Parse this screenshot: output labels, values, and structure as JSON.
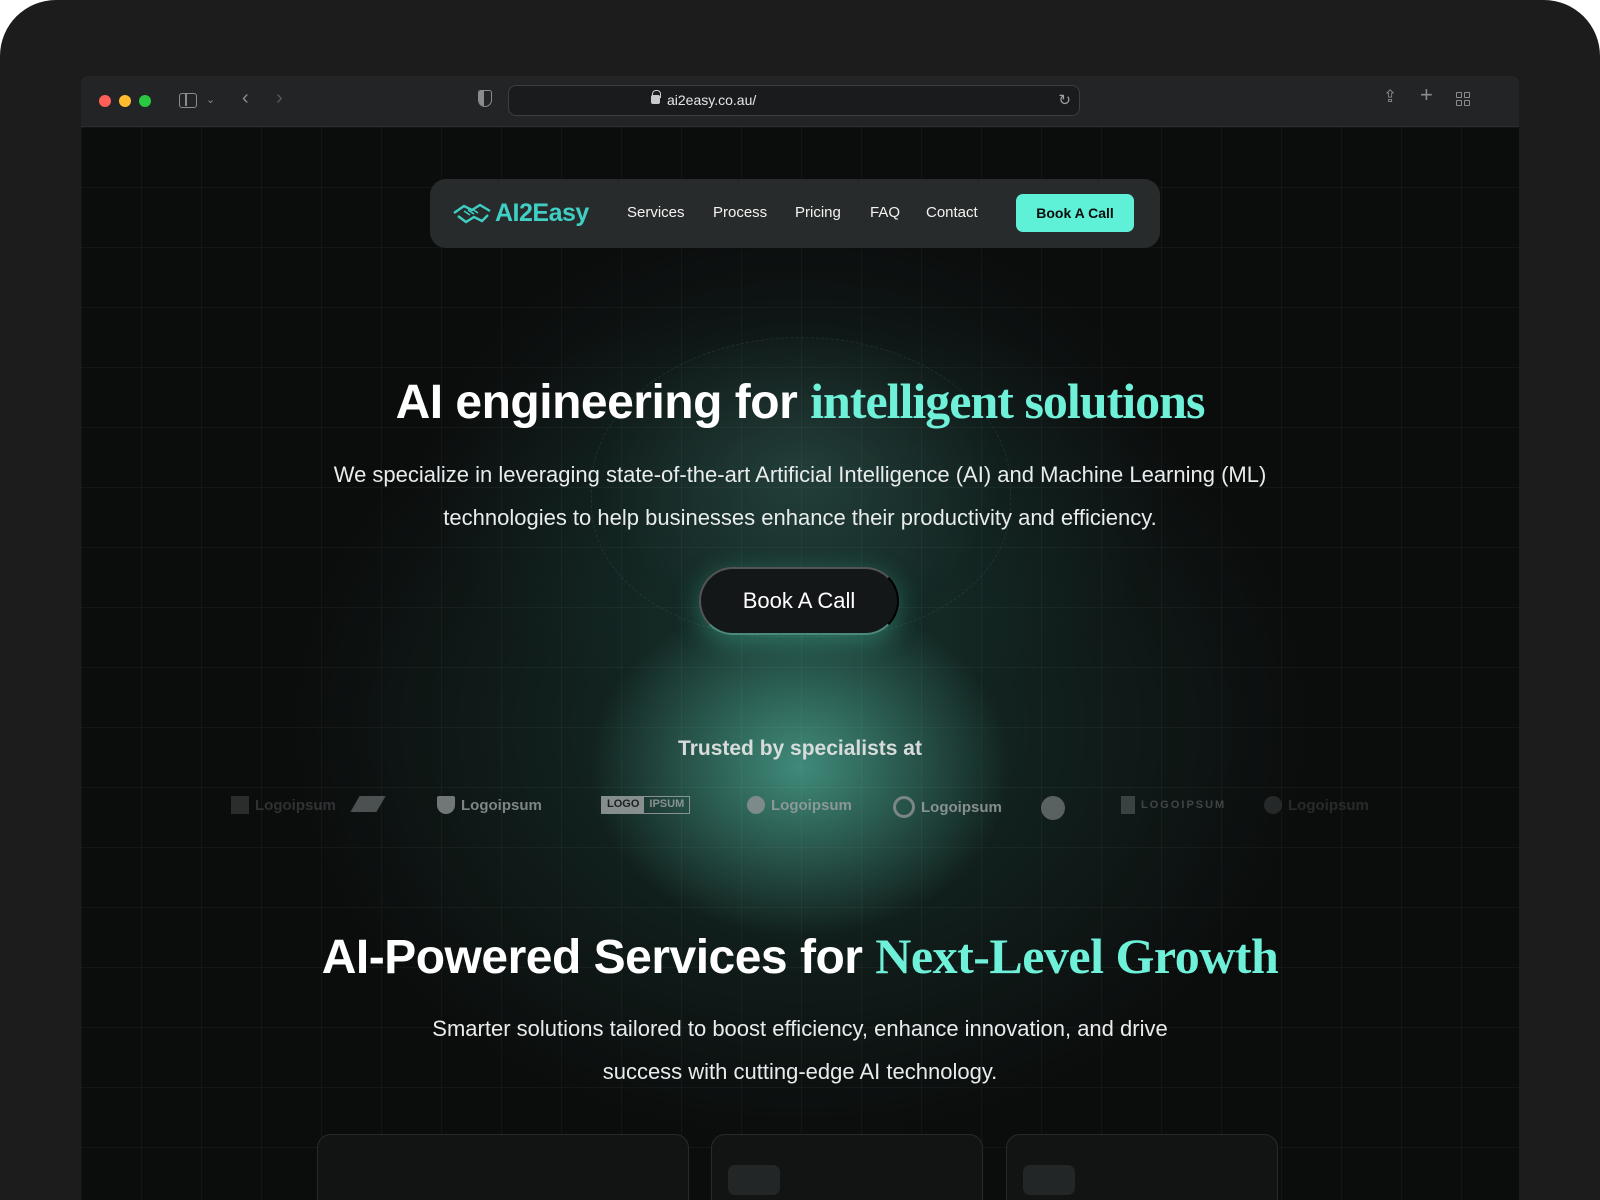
{
  "browser": {
    "url": "ai2easy.co.au/"
  },
  "nav": {
    "logo_text": "AI2Easy",
    "links": [
      "Services",
      "Process",
      "Pricing",
      "FAQ",
      "Contact"
    ],
    "cta": "Book A Call"
  },
  "hero": {
    "title_plain": "AI engineering for ",
    "title_accent": "intelligent solutions",
    "subtitle": "We specialize in leveraging state-of-the-art Artificial Intelligence (AI) and Machine Learning (ML) technologies to help businesses enhance their productivity and efficiency.",
    "cta": "Book A Call"
  },
  "trusted": {
    "heading": "Trusted by specialists at",
    "logos": [
      "Logoipsum",
      "Logoipsum",
      "LOGO",
      "IPSUM",
      "Logoipsum",
      "Logoipsum",
      "LOGOIPSUM",
      "Logoipsum"
    ]
  },
  "services": {
    "title_plain": "AI-Powered Services for ",
    "title_accent": "Next-Level Growth",
    "subtitle": "Smarter solutions tailored to boost efficiency, enhance innovation, and drive success with cutting-edge AI technology."
  },
  "colors": {
    "accent": "#5ff0d8",
    "brand_logo": "#3fcfc4",
    "background": "#0b0c0c"
  }
}
